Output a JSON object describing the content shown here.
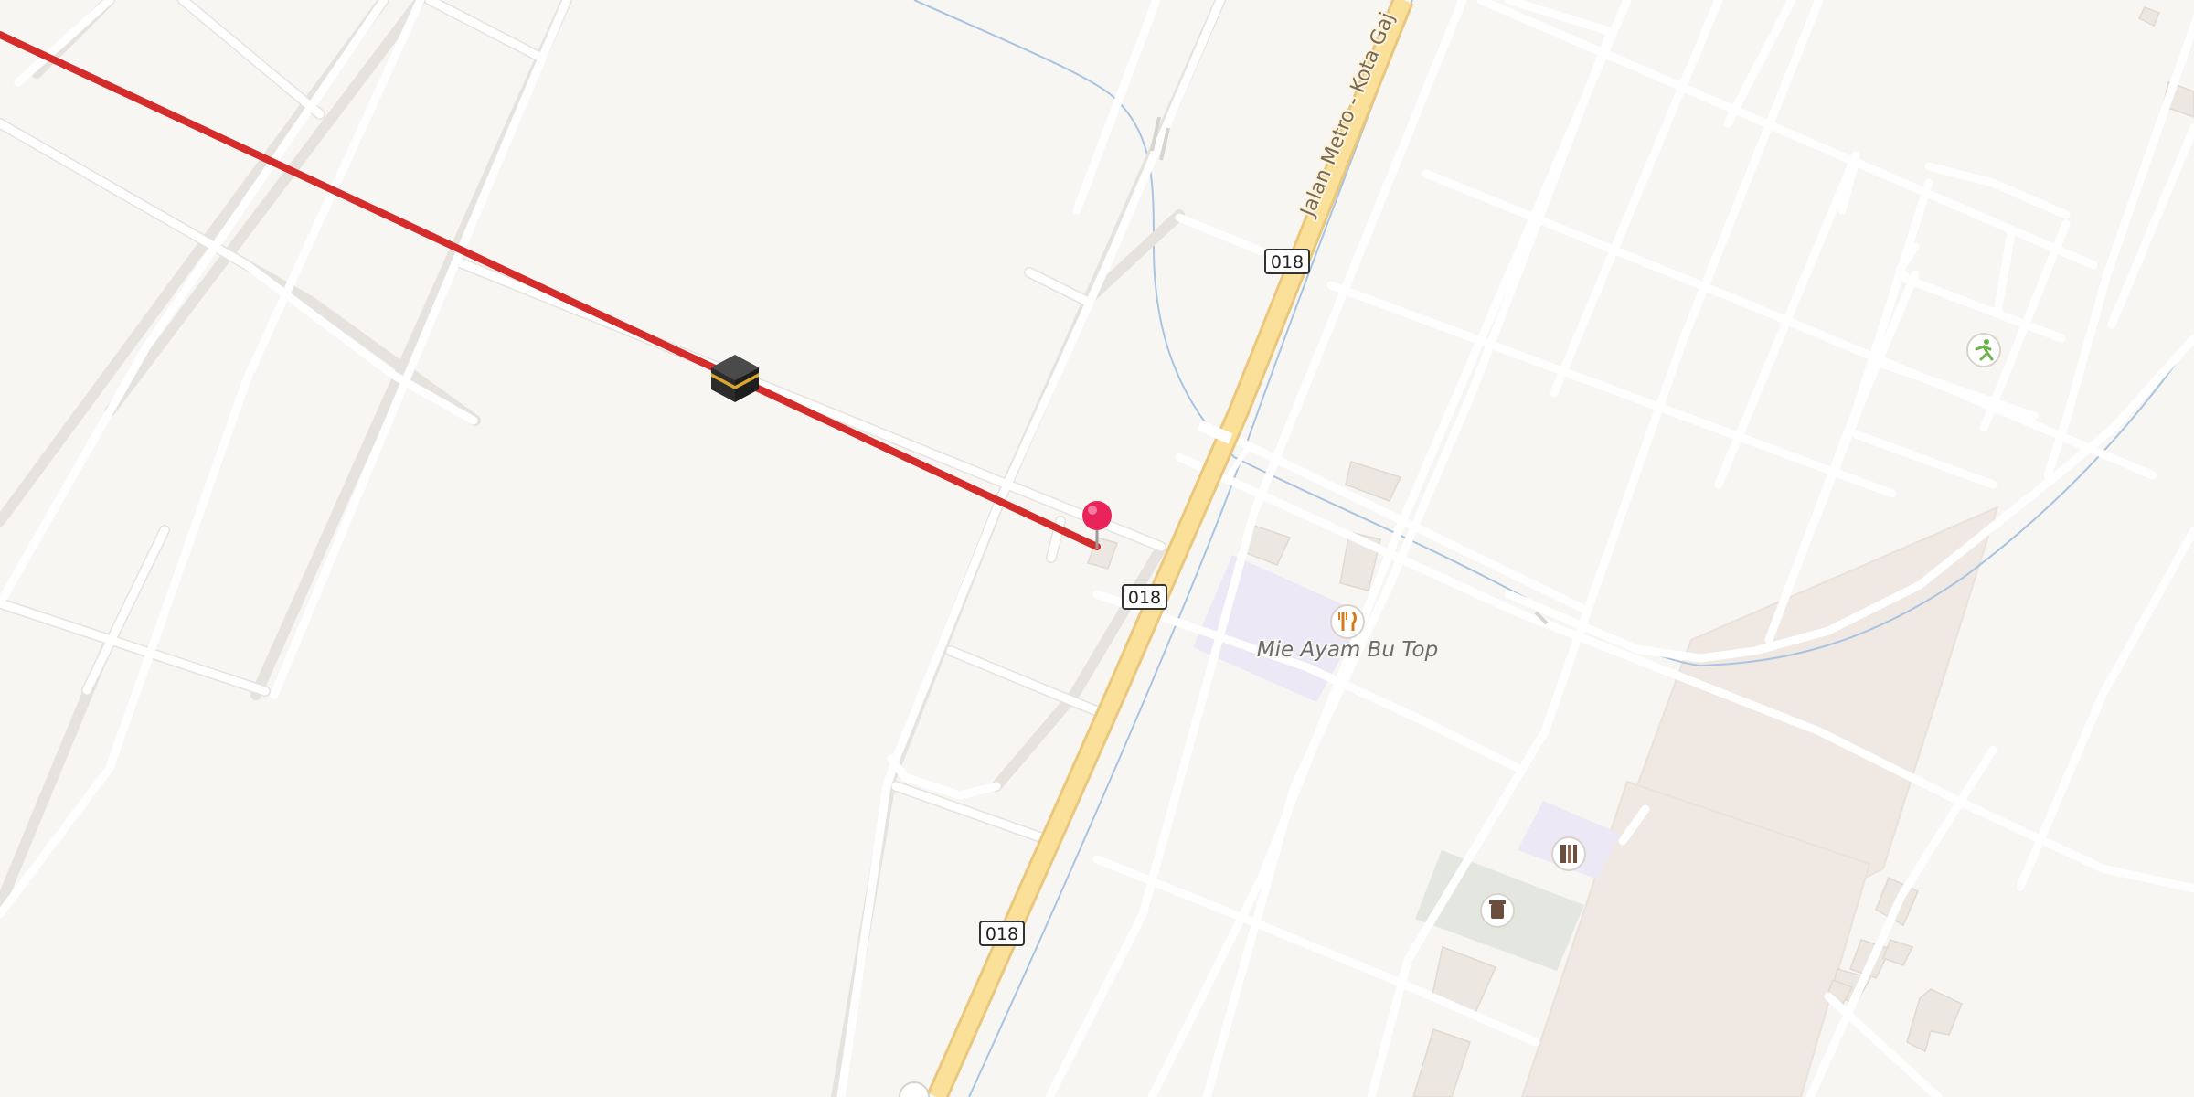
{
  "map": {
    "road_main_label": "Jalan Metro - Kota Gaj",
    "route_shields": [
      "018",
      "018",
      "018"
    ],
    "poi_restaurant_label": "Mie Ayam Bu Top",
    "colors": {
      "background": "#f8f6f3",
      "minor_road": "#ffffff",
      "major_road": "#fbe09a",
      "route_line": "#d42b2b",
      "pin": "#e8245a",
      "landuse_purple": "#ece8f6",
      "landuse_green": "#e4e7e0",
      "industrial": "#efe8e3",
      "water": "#a8c4e0"
    },
    "icons": {
      "kaaba": "kaaba-icon",
      "pin": "location-pin-icon",
      "restaurant": "fork-knife-icon",
      "school": "school-icon",
      "sport": "running-person-icon",
      "cemetery": "tombstone-icon"
    }
  }
}
